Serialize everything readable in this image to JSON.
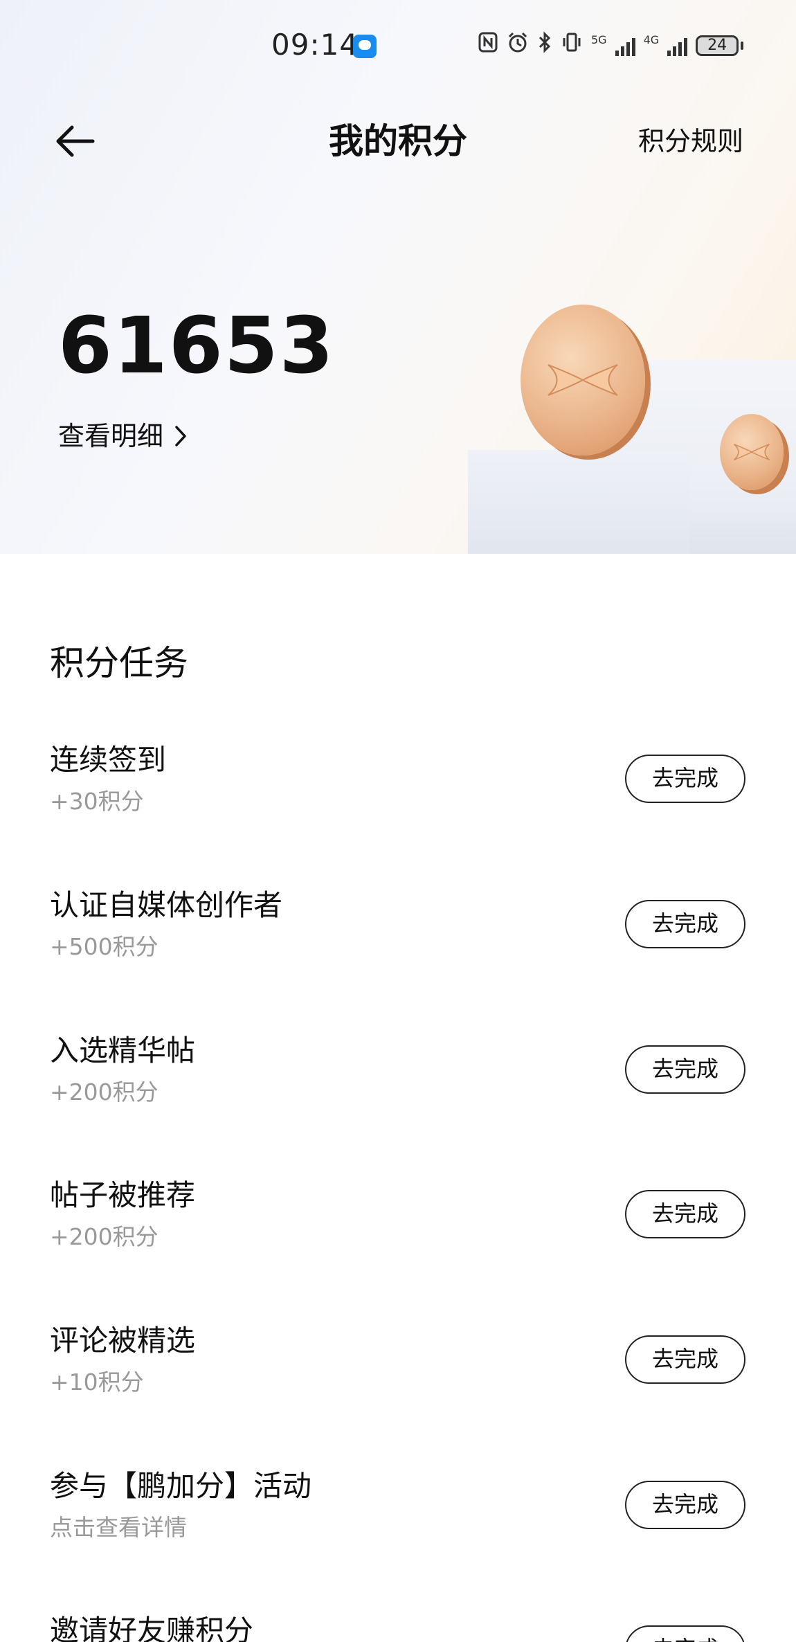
{
  "status_bar": {
    "time": "09:14",
    "net_5g": "5G",
    "net_4g": "4G",
    "battery": "24"
  },
  "header": {
    "title": "我的积分",
    "rules_link": "积分规则"
  },
  "points": {
    "value": "61653",
    "detail_link": "查看明细"
  },
  "tasks_section": {
    "title": "积分任务",
    "tasks": [
      {
        "name": "连续签到",
        "reward": "+30积分",
        "button": "去完成"
      },
      {
        "name": "认证自媒体创作者",
        "reward": "+500积分",
        "button": "去完成"
      },
      {
        "name": "入选精华帖",
        "reward": "+200积分",
        "button": "去完成"
      },
      {
        "name": "帖子被推荐",
        "reward": "+200积分",
        "button": "去完成"
      },
      {
        "name": "评论被精选",
        "reward": "+10积分",
        "button": "去完成"
      },
      {
        "name": "参与【鹏加分】活动",
        "reward": "点击查看详情",
        "button": "去完成"
      },
      {
        "name": "邀请好友赚积分",
        "reward": "",
        "button": "去完成"
      }
    ]
  }
}
